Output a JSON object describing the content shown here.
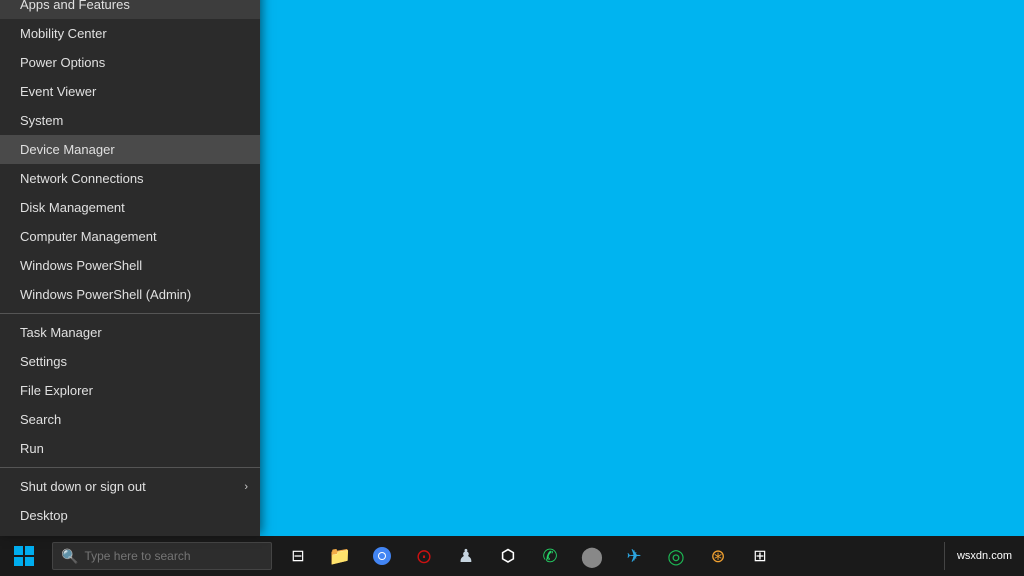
{
  "desktop": {
    "background_color": "#00adef"
  },
  "context_menu": {
    "items": [
      {
        "id": "apps-features",
        "label": "Apps and Features",
        "separator_after": false,
        "has_arrow": false
      },
      {
        "id": "mobility-center",
        "label": "Mobility Center",
        "separator_after": false,
        "has_arrow": false
      },
      {
        "id": "power-options",
        "label": "Power Options",
        "separator_after": false,
        "has_arrow": false
      },
      {
        "id": "event-viewer",
        "label": "Event Viewer",
        "separator_after": false,
        "has_arrow": false
      },
      {
        "id": "system",
        "label": "System",
        "separator_after": false,
        "has_arrow": false
      },
      {
        "id": "device-manager",
        "label": "Device Manager",
        "separator_after": false,
        "has_arrow": false,
        "highlighted": true
      },
      {
        "id": "network-connections",
        "label": "Network Connections",
        "separator_after": false,
        "has_arrow": false
      },
      {
        "id": "disk-management",
        "label": "Disk Management",
        "separator_after": false,
        "has_arrow": false
      },
      {
        "id": "computer-management",
        "label": "Computer Management",
        "separator_after": false,
        "has_arrow": false
      },
      {
        "id": "windows-powershell",
        "label": "Windows PowerShell",
        "separator_after": false,
        "has_arrow": false
      },
      {
        "id": "windows-powershell-admin",
        "label": "Windows PowerShell (Admin)",
        "separator_after": true,
        "has_arrow": false
      },
      {
        "id": "task-manager",
        "label": "Task Manager",
        "separator_after": false,
        "has_arrow": false
      },
      {
        "id": "settings",
        "label": "Settings",
        "separator_after": false,
        "has_arrow": false
      },
      {
        "id": "file-explorer",
        "label": "File Explorer",
        "separator_after": false,
        "has_arrow": false
      },
      {
        "id": "search",
        "label": "Search",
        "separator_after": false,
        "has_arrow": false
      },
      {
        "id": "run",
        "label": "Run",
        "separator_after": true,
        "has_arrow": false
      },
      {
        "id": "shut-down",
        "label": "Shut down or sign out",
        "separator_after": false,
        "has_arrow": true
      },
      {
        "id": "desktop",
        "label": "Desktop",
        "separator_after": false,
        "has_arrow": false
      }
    ]
  },
  "taskbar": {
    "search_placeholder": "Type here to search",
    "clock": {
      "time": "wsxdn.com"
    },
    "tray_icons": [
      {
        "id": "task-view",
        "symbol": "⊞",
        "label": "Task View"
      },
      {
        "id": "file-explorer",
        "symbol": "📁",
        "label": "File Explorer"
      },
      {
        "id": "chrome",
        "symbol": "◉",
        "label": "Chrome"
      },
      {
        "id": "opera",
        "symbol": "⊙",
        "label": "Opera"
      },
      {
        "id": "steam",
        "symbol": "♟",
        "label": "Steam"
      },
      {
        "id": "epic-games",
        "symbol": "⬡",
        "label": "Epic Games"
      },
      {
        "id": "whatsapp",
        "symbol": "✆",
        "label": "WhatsApp"
      },
      {
        "id": "app7",
        "symbol": "⬤",
        "label": "App7"
      },
      {
        "id": "telegram",
        "symbol": "✈",
        "label": "Telegram"
      },
      {
        "id": "spotify",
        "symbol": "◎",
        "label": "Spotify"
      },
      {
        "id": "app10",
        "symbol": "⊛",
        "label": "App10"
      },
      {
        "id": "app11",
        "symbol": "⊞",
        "label": "App11"
      }
    ]
  }
}
